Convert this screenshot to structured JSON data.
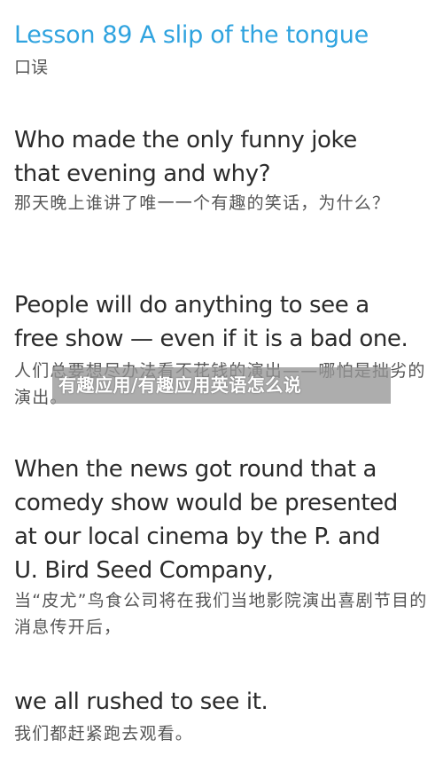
{
  "lesson": {
    "title": "Lesson 89 A slip of the tongue",
    "subtitle": "口误"
  },
  "paragraphs": [
    {
      "en_lines": [
        "Who made the only funny joke",
        "that evening and why?"
      ],
      "cn": "那天晚上谁讲了唯一一个有趣的笑话，为什么？"
    },
    {
      "en_lines": [
        "People will do anything to see a",
        "free show — even if it is a bad one."
      ],
      "cn": "人们总要想尽办法看不花钱的演出——哪怕是拙劣的演出。"
    },
    {
      "en_lines": [
        "When the news got round that a",
        "comedy show would be presented",
        "at our local cinema by the P. and",
        "U. Bird Seed Company,"
      ],
      "cn": "当“皮尤”鸟食公司将在我们当地影院演出喜剧节目的消息传开后，"
    },
    {
      "en_lines": [
        "we all rushed to see it."
      ],
      "cn": "我们都赶紧跑去观看。"
    }
  ],
  "watermark": {
    "text": "有趣应用/有趣应用英语怎么说"
  }
}
